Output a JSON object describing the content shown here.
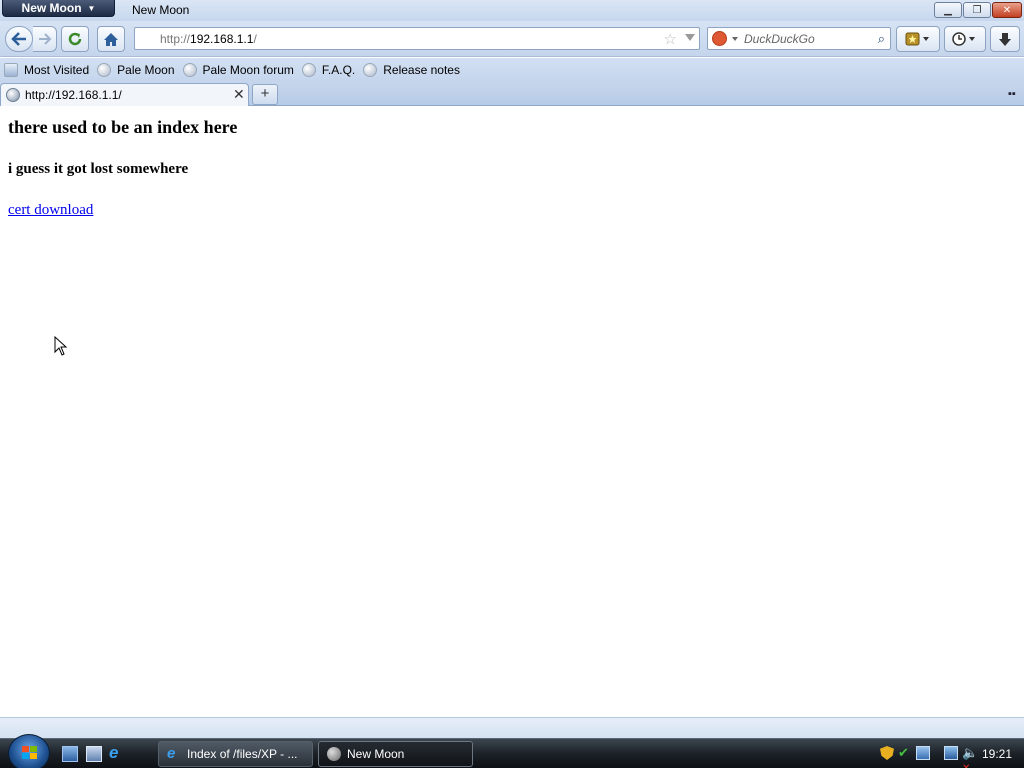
{
  "window": {
    "app_menu_label": "New Moon",
    "title": "New Moon"
  },
  "toolbar": {
    "url_prefix": "http://",
    "url_host": "192.168.1.1",
    "url_suffix": "/",
    "search_placeholder": "DuckDuckGo"
  },
  "bookmarks": [
    {
      "label": "Most Visited",
      "icon": "most-visited-icon"
    },
    {
      "label": "Pale Moon",
      "icon": "globe-icon"
    },
    {
      "label": "Pale Moon forum",
      "icon": "globe-icon"
    },
    {
      "label": "F.A.Q.",
      "icon": "globe-icon"
    },
    {
      "label": "Release notes",
      "icon": "globe-icon"
    }
  ],
  "tabs": [
    {
      "label": "http://192.168.1.1/",
      "active": true
    }
  ],
  "page": {
    "heading": "there used to be an index here",
    "subheading": "i guess it got lost somewhere",
    "link_text": "cert download"
  },
  "taskbar": {
    "tasks": [
      {
        "label": "Index of /files/XP - ..."
      },
      {
        "label": "New Moon",
        "active": true
      }
    ],
    "clock": "19:21"
  },
  "colors": {
    "link": "#0000ee",
    "chrome_blue": "#c6d7ee",
    "close_red": "#c23f22"
  }
}
